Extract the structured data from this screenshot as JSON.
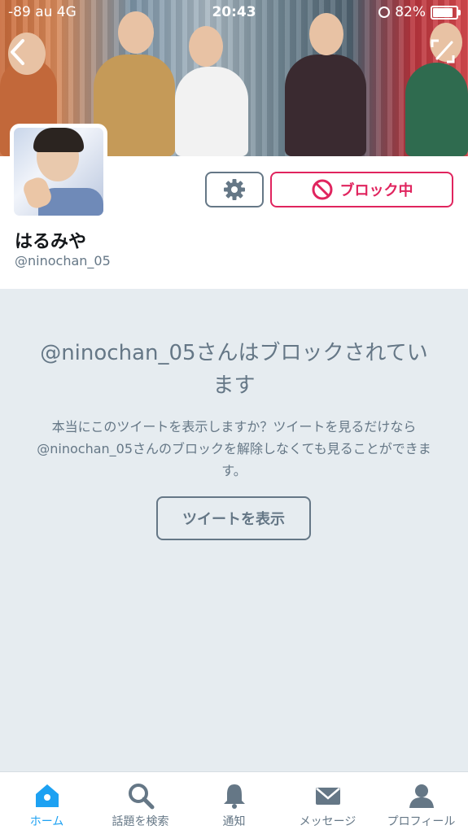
{
  "status_bar": {
    "signal": "-89",
    "carrier": "au",
    "network": "4G",
    "time": "20:43",
    "battery": "82%"
  },
  "profile": {
    "display_name": "はるみや",
    "handle": "@ninochan_05",
    "block_button_label": "ブロック中"
  },
  "blocked_notice": {
    "title": "@ninochan_05さんはブロックされています",
    "description": "本当にこのツイートを表示しますか？ツイートを見るだけなら@ninochan_05さんのブロックを解除しなくても見ることができます。",
    "show_tweets_label": "ツイートを表示"
  },
  "tab_bar": {
    "items": [
      {
        "label": "ホーム",
        "icon": "home-icon"
      },
      {
        "label": "話題を検索",
        "icon": "search-icon"
      },
      {
        "label": "通知",
        "icon": "bell-icon"
      },
      {
        "label": "メッセージ",
        "icon": "envelope-icon"
      },
      {
        "label": "プロフィール",
        "icon": "person-icon"
      }
    ]
  },
  "colors": {
    "accent": "#1da1f2",
    "block_red": "#e0245e",
    "muted": "#657786",
    "background": "#e6ecf0"
  }
}
